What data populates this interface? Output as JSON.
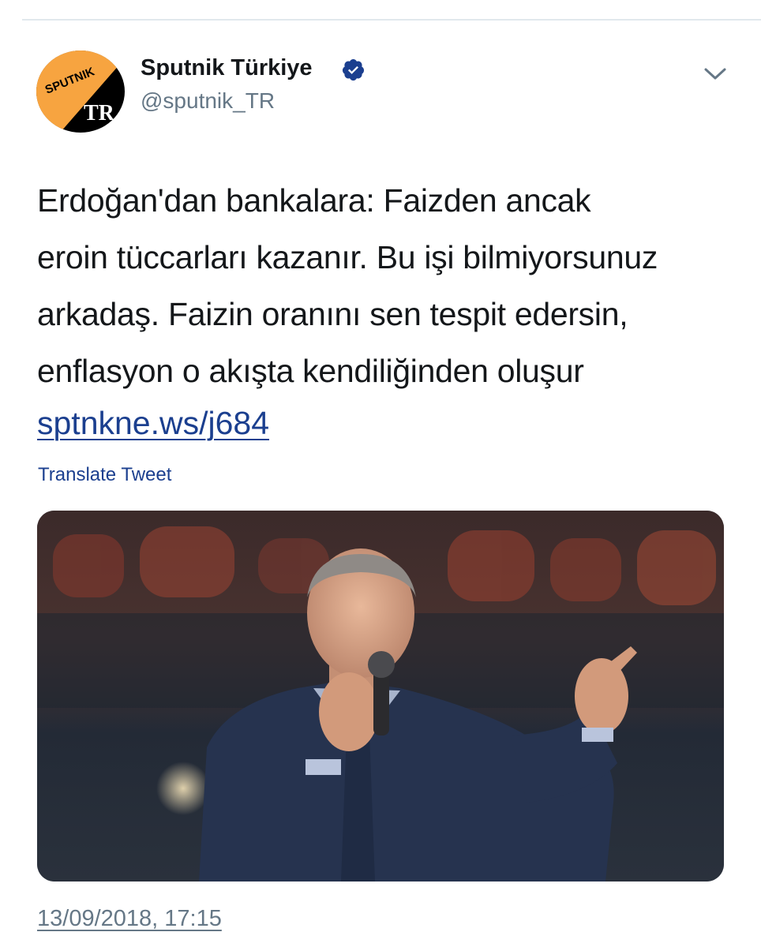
{
  "account": {
    "display_name": "Sputnik Türkiye",
    "handle": "@sputnik_TR",
    "verified": true,
    "avatar_icon": "sputnik-tr-logo",
    "avatar_brand_text": "SPUTNIK",
    "avatar_region_text": "TR"
  },
  "menu": {
    "icon": "chevron-down-icon"
  },
  "tweet": {
    "lines": [
      "Erdoğan'dan bankalara: Faizden ancak",
      "eroin tüccarları kazanır. Bu işi bilmiyorsunuz",
      "arkadaş. Faizin oranını sen tespit edersin,",
      "enflasyon o akışta kendiliğinden oluşur"
    ],
    "link": "sptnkne.ws/j684",
    "translate_label": "Translate Tweet",
    "timestamp": "13/09/2018, 17:15"
  },
  "colors": {
    "link": "#1b3f8f",
    "verified": "#1b3f8f",
    "secondary_text": "#657786",
    "brand_orange": "#f7a440"
  }
}
